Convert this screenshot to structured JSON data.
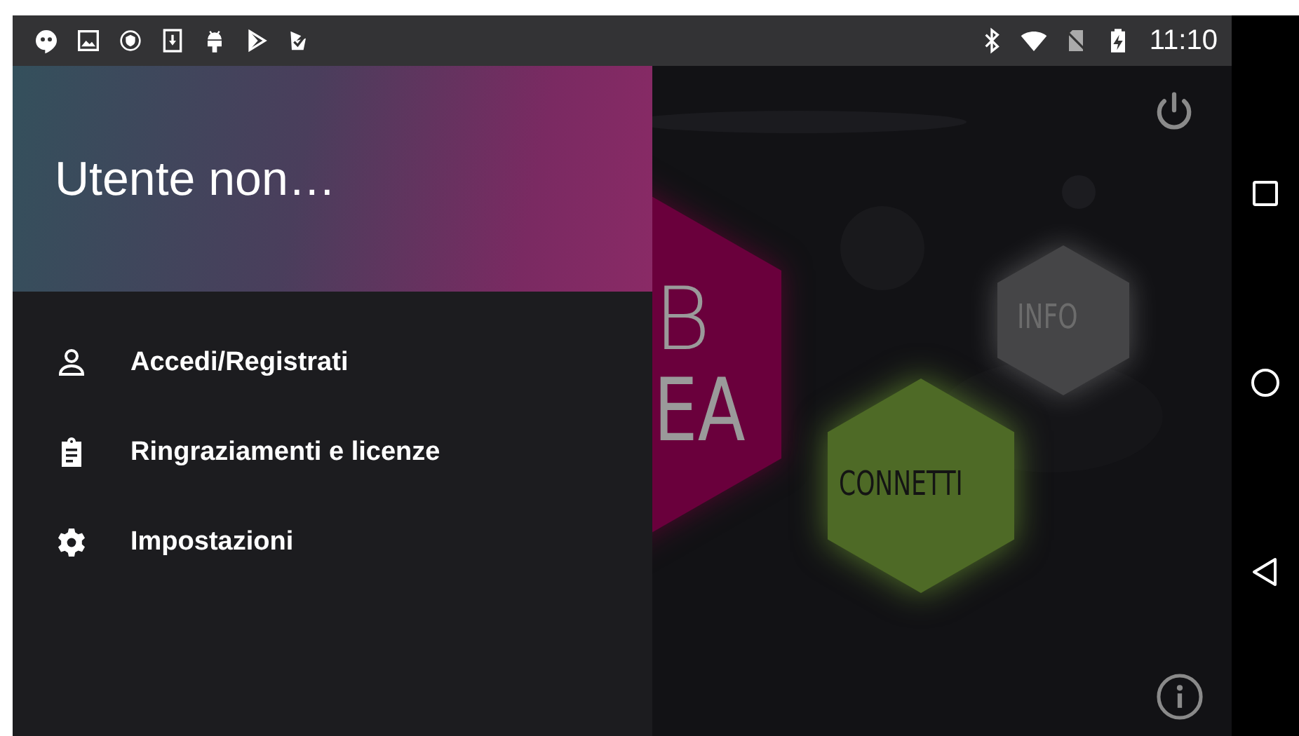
{
  "status_bar": {
    "time": "11:10"
  },
  "drawer": {
    "title": "Utente non…",
    "items": [
      {
        "label": "Accedi/Registrati"
      },
      {
        "label": "Ringraziamenti e licenze"
      },
      {
        "label": "Impostazioni"
      }
    ]
  },
  "main": {
    "hexagons": [
      {
        "kind": "brand",
        "lines": [
          "B",
          "EA"
        ],
        "color": "#6a003c"
      },
      {
        "kind": "info",
        "lines": [
          "INFO"
        ],
        "color": "#454547"
      },
      {
        "kind": "connect",
        "lines": [
          "CONNETTI"
        ],
        "color": "#4e6a26"
      }
    ]
  }
}
